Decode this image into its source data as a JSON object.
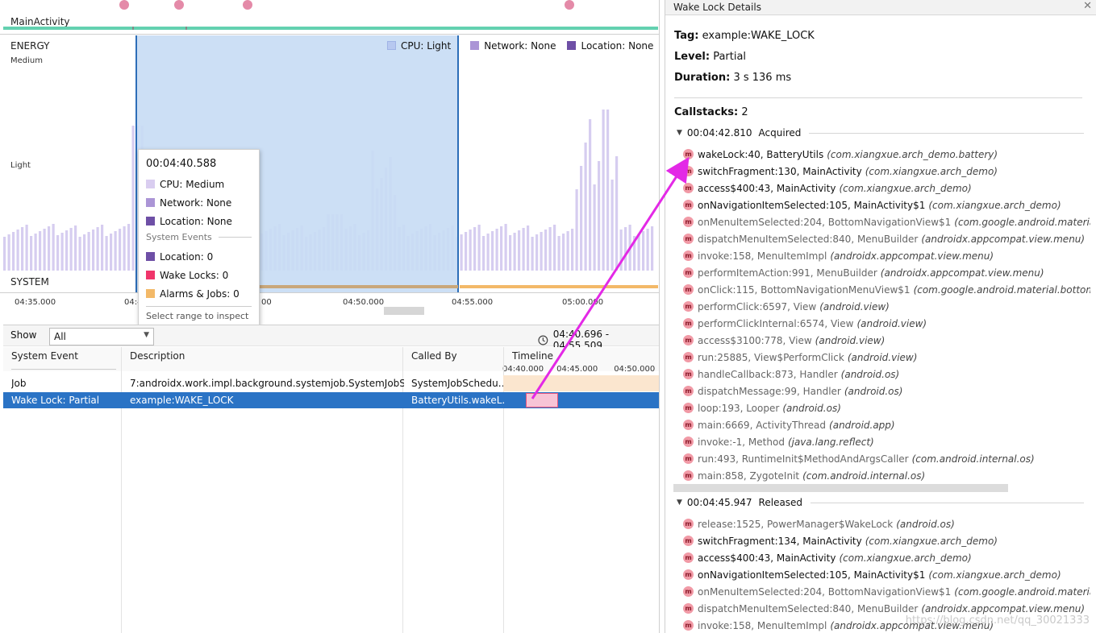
{
  "left": {
    "activity_label": "MainActivity",
    "energy_label": "ENERGY",
    "level_medium": "Medium",
    "level_light": "Light",
    "system_label": "SYSTEM",
    "legend": {
      "cpu": "CPU: Light",
      "network": "Network: None",
      "location": "Location: None"
    },
    "time_ticks": [
      "04:35.000",
      "04:4",
      "00",
      "04:50.000",
      "04:55.000",
      "05:00.000"
    ],
    "tooltip": {
      "time": "00:04:40.588",
      "cpu": "CPU: Medium",
      "network": "Network: None",
      "location": "Location: None",
      "system_events": "System Events",
      "location_events": "Location: 0",
      "wake_locks": "Wake Locks: 0",
      "alarms_jobs": "Alarms & Jobs: 0",
      "hint": "Select range to inspect"
    },
    "show_label": "Show",
    "show_value": "All",
    "range": "04:40.696 - 04:55.509",
    "columns": {
      "system_event": "System Event",
      "description": "Description",
      "called_by": "Called By",
      "timeline": "Timeline"
    },
    "timeline_ticks": [
      "04:40.000",
      "04:45.000",
      "04:50.000",
      "0"
    ],
    "rows": [
      {
        "event": "Job",
        "description": "7:androidx.work.impl.background.systemjob.SystemJobS…",
        "called_by": "SystemJobSchedu…"
      },
      {
        "event": "Wake Lock: Partial",
        "description": "example:WAKE_LOCK",
        "called_by": "BatteryUtils.wakeL…"
      }
    ],
    "colors": {
      "cpu": "#d9cdf0",
      "network": "#ab95d6",
      "location": "#6e4fa6",
      "wake": "#f0356b",
      "alarms": "#f3b968",
      "selection": "#c8dcf4",
      "accent": "#2d6eb8"
    }
  },
  "right": {
    "title": "Wake Lock Details",
    "tag_label": "Tag:",
    "tag_value": "example:WAKE_LOCK",
    "level_label": "Level:",
    "level_value": "Partial",
    "duration_label": "Duration:",
    "duration_value": "3 s 136 ms",
    "callstacks_label": "Callstacks:",
    "callstacks_value": "2",
    "acquired_time": "00:04:42.810",
    "acquired_label": "Acquired",
    "acquired_frames": [
      {
        "m": "wakeLock:40, BatteryUtils",
        "p": "(com.xiangxue.arch_demo.battery)",
        "bold": true
      },
      {
        "m": "switchFragment:130, MainActivity",
        "p": "(com.xiangxue.arch_demo)",
        "bold": true
      },
      {
        "m": "access$400:43, MainActivity",
        "p": "(com.xiangxue.arch_demo)",
        "bold": true
      },
      {
        "m": "onNavigationItemSelected:105, MainActivity$1",
        "p": "(com.xiangxue.arch_demo)",
        "bold": true
      },
      {
        "m": "onMenuItemSelected:204, BottomNavigationView$1",
        "p": "(com.google.android.materia",
        "bold": false
      },
      {
        "m": "dispatchMenuItemSelected:840, MenuBuilder",
        "p": "(androidx.appcompat.view.menu)",
        "bold": false
      },
      {
        "m": "invoke:158, MenuItemImpl",
        "p": "(androidx.appcompat.view.menu)",
        "bold": false
      },
      {
        "m": "performItemAction:991, MenuBuilder",
        "p": "(androidx.appcompat.view.menu)",
        "bold": false
      },
      {
        "m": "onClick:115, BottomNavigationMenuView$1",
        "p": "(com.google.android.material.bottom",
        "bold": false
      },
      {
        "m": "performClick:6597, View",
        "p": "(android.view)",
        "bold": false
      },
      {
        "m": "performClickInternal:6574, View",
        "p": "(android.view)",
        "bold": false
      },
      {
        "m": "access$3100:778, View",
        "p": "(android.view)",
        "bold": false
      },
      {
        "m": "run:25885, View$PerformClick",
        "p": "(android.view)",
        "bold": false
      },
      {
        "m": "handleCallback:873, Handler",
        "p": "(android.os)",
        "bold": false
      },
      {
        "m": "dispatchMessage:99, Handler",
        "p": "(android.os)",
        "bold": false
      },
      {
        "m": "loop:193, Looper",
        "p": "(android.os)",
        "bold": false
      },
      {
        "m": "main:6669, ActivityThread",
        "p": "(android.app)",
        "bold": false
      },
      {
        "m": "invoke:-1, Method",
        "p": "(java.lang.reflect)",
        "bold": false
      },
      {
        "m": "run:493, RuntimeInit$MethodAndArgsCaller",
        "p": "(com.android.internal.os)",
        "bold": false
      },
      {
        "m": "main:858, ZygoteInit",
        "p": "(com.android.internal.os)",
        "bold": false
      }
    ],
    "released_time": "00:04:45.947",
    "released_label": "Released",
    "released_frames": [
      {
        "m": "release:1525, PowerManager$WakeLock",
        "p": "(android.os)",
        "bold": false
      },
      {
        "m": "switchFragment:134, MainActivity",
        "p": "(com.xiangxue.arch_demo)",
        "bold": true
      },
      {
        "m": "access$400:43, MainActivity",
        "p": "(com.xiangxue.arch_demo)",
        "bold": true
      },
      {
        "m": "onNavigationItemSelected:105, MainActivity$1",
        "p": "(com.xiangxue.arch_demo)",
        "bold": true
      },
      {
        "m": "onMenuItemSelected:204, BottomNavigationView$1",
        "p": "(com.google.android.materia",
        "bold": false
      },
      {
        "m": "dispatchMenuItemSelected:840, MenuBuilder",
        "p": "(androidx.appcompat.view.menu)",
        "bold": false
      },
      {
        "m": "invoke:158, MenuItemImpl",
        "p": "(androidx.appcompat.view.menu)",
        "bold": false
      }
    ],
    "watermark": "https://blog.csdn.net/qq_30021333"
  }
}
